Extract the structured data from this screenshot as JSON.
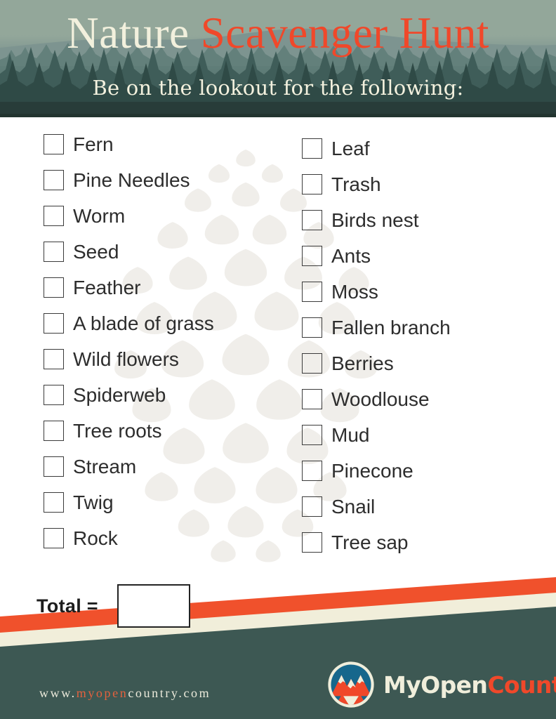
{
  "header": {
    "title_part1": "Nature",
    "title_part2": "Scavenger Hunt",
    "subtitle": "Be on the lookout for the following:",
    "colors": {
      "sky": "#93a79a",
      "forest_dark": "#2b3f3b",
      "title_cream": "#f2f0dd",
      "title_orange": "#f0482a"
    }
  },
  "checklist": {
    "left_column": [
      {
        "label": "Fern",
        "checked": false
      },
      {
        "label": "Pine Needles",
        "checked": false
      },
      {
        "label": "Worm",
        "checked": false
      },
      {
        "label": "Seed",
        "checked": false
      },
      {
        "label": "Feather",
        "checked": false
      },
      {
        "label": "A blade of grass",
        "checked": false
      },
      {
        "label": "Wild flowers",
        "checked": false
      },
      {
        "label": "Spiderweb",
        "checked": false
      },
      {
        "label": "Tree roots",
        "checked": false
      },
      {
        "label": "Stream",
        "checked": false
      },
      {
        "label": "Twig",
        "checked": false
      },
      {
        "label": "Rock",
        "checked": false
      }
    ],
    "right_column": [
      {
        "label": "Leaf",
        "checked": false
      },
      {
        "label": "Trash",
        "checked": false
      },
      {
        "label": "Birds nest",
        "checked": false
      },
      {
        "label": "Ants",
        "checked": false
      },
      {
        "label": "Moss",
        "checked": false
      },
      {
        "label": "Fallen branch",
        "checked": false
      },
      {
        "label": "Berries",
        "checked": false
      },
      {
        "label": "Woodlouse",
        "checked": false
      },
      {
        "label": "Mud",
        "checked": false
      },
      {
        "label": "Pinecone",
        "checked": false
      },
      {
        "label": "Snail",
        "checked": false
      },
      {
        "label": "Tree sap",
        "checked": false
      }
    ]
  },
  "total": {
    "label": "Total =",
    "value": ""
  },
  "footer": {
    "url_part1": "www.",
    "url_part2": "myopen",
    "url_part3": "country.com",
    "brand_part1": "MyOpen",
    "brand_part2": "Country",
    "logo_icon": "mountain-circle-logo",
    "colors": {
      "stripe_orange": "#f0512c",
      "stripe_cream": "#f1eeda",
      "band_green": "#3d5853"
    }
  }
}
